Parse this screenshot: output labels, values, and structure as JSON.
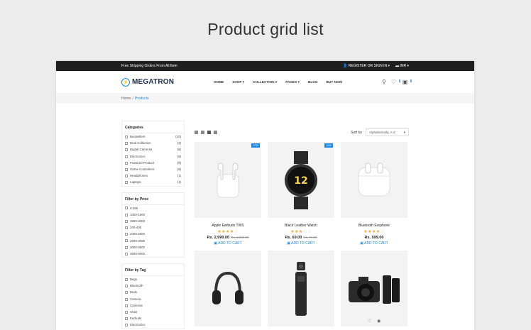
{
  "heading": "Product grid list",
  "topbar": {
    "promo": "Free Shipping Orders From All Item",
    "account": "REGISTER OR SIGN IN",
    "currency": "INR"
  },
  "header": {
    "brand": "MEGATRON",
    "nav": [
      "HOME",
      "SHOP",
      "COLLECTION",
      "PAGES",
      "BLOG",
      "BUY NOW"
    ],
    "wishlist_count": "0",
    "cart_count": "0"
  },
  "breadcrumb": {
    "home": "Home",
    "current": "Products"
  },
  "sidebar": {
    "categories_title": "Categories",
    "categories": [
      {
        "label": "Bestsellers",
        "count": "(10)"
      },
      {
        "label": "Deal Collection",
        "count": "(3)"
      },
      {
        "label": "Digital Cameras",
        "count": "(8)"
      },
      {
        "label": "Electronics",
        "count": "(8)"
      },
      {
        "label": "Featured Product",
        "count": "(9)"
      },
      {
        "label": "Game Controllers",
        "count": "(9)"
      },
      {
        "label": "Headphones",
        "count": "(1)"
      },
      {
        "label": "Laptops",
        "count": "(1)"
      }
    ],
    "price_title": "Filter by Price",
    "prices": [
      "0-250",
      "1000-1500",
      "1500-2000",
      "200-400",
      "2000-2500",
      "2500-3000",
      "3000-3500",
      "3500-4000"
    ],
    "tag_title": "Filter by Tag",
    "tags": [
      "Bags",
      "Bluetooth",
      "Buds",
      "Camera",
      "Cameras",
      "Chair",
      "Earbuds",
      "Electronics"
    ]
  },
  "toolbar": {
    "sort_label": "Sort by",
    "sort_value": "Alphabetically, A-Z"
  },
  "products": [
    {
      "name": "Apple Earbuds TWS",
      "price": "Rs. 2,999.00",
      "old": "Rs. 3,599.00",
      "sale": "-17%",
      "stars": "★★★★",
      "off": "☆",
      "cart": "ADD TO CART"
    },
    {
      "name": "Black Leather Watch",
      "price": "Rs. 69.00",
      "old": "Rs. 79.00",
      "sale": "-13%",
      "stars": "★★★",
      "off": "☆☆",
      "cart": "ADD TO CART"
    },
    {
      "name": "Bluetooth Earphone",
      "price": "Rs. 599.00",
      "old": "",
      "sale": "",
      "stars": "★★★★",
      "off": "☆",
      "cart": "ADD TO CART"
    }
  ],
  "watch_display": "12"
}
